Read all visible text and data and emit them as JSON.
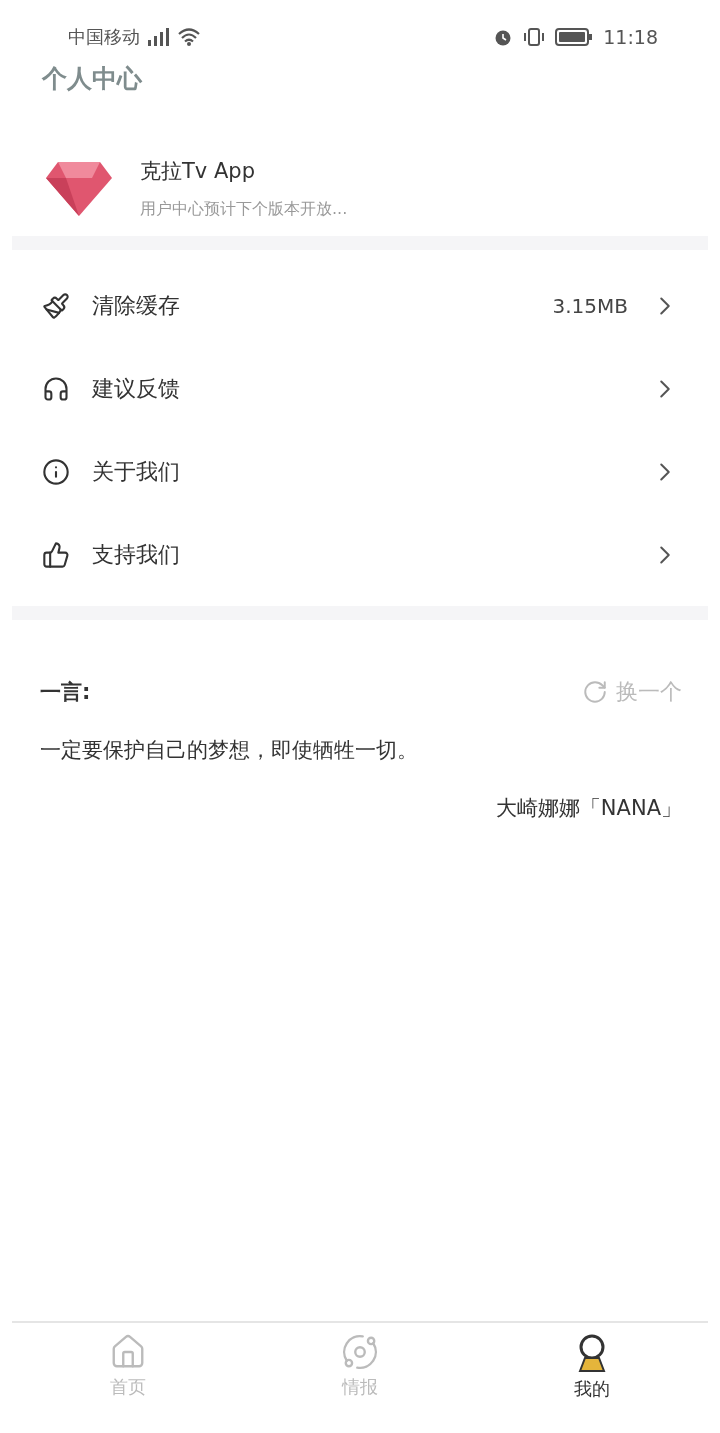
{
  "status_bar": {
    "carrier": "中国移动",
    "time": "11:18"
  },
  "header": {
    "title": "个人中心"
  },
  "profile": {
    "name": "克拉Tv App",
    "subtitle": "用户中心预计下个版本开放..."
  },
  "menu": [
    {
      "kind": "cache",
      "label": "清除缓存",
      "value": "3.15MB"
    },
    {
      "kind": "feedback",
      "label": "建议反馈"
    },
    {
      "kind": "about",
      "label": "关于我们"
    },
    {
      "kind": "support",
      "label": "支持我们"
    }
  ],
  "quote": {
    "heading": "一言:",
    "refresh": "换一个",
    "text": "一定要保护自己的梦想，即使牺牲一切。",
    "author": "大崎娜娜「NANA」"
  },
  "tabs": [
    {
      "kind": "home",
      "label": "首页",
      "selected": false
    },
    {
      "kind": "news",
      "label": "情报",
      "selected": false
    },
    {
      "kind": "me",
      "label": "我的",
      "selected": true
    }
  ]
}
